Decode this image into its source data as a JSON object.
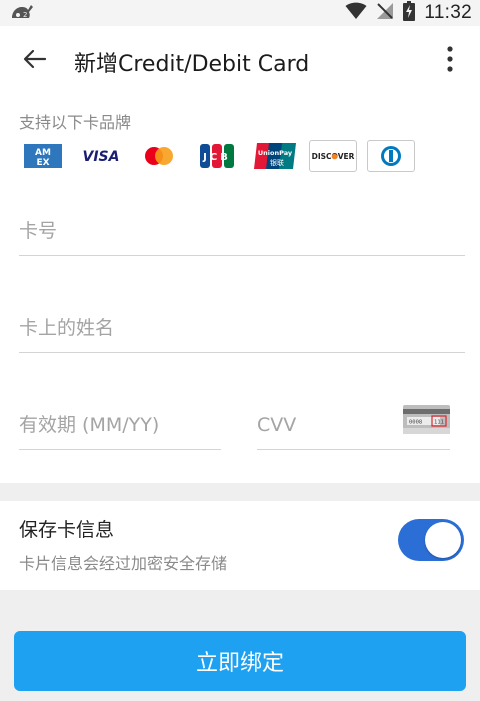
{
  "status": {
    "time": "11:32",
    "icons": [
      "notification-app-icon",
      "wifi-icon",
      "no-signal-icon",
      "battery-charging-icon"
    ]
  },
  "appbar": {
    "title": "新增Credit/Debit Card",
    "back_icon": "arrow-left-icon",
    "more_icon": "more-vertical-icon"
  },
  "brands": {
    "label": "支持以下卡品牌",
    "items": [
      {
        "name": "American Express",
        "text_line1": "AM",
        "text_line2": "EX",
        "color": "#2e77bc"
      },
      {
        "name": "Visa",
        "text": "VISA",
        "color": "#1a1f71"
      },
      {
        "name": "Mastercard",
        "colors": [
          "#eb001b",
          "#f79e1b"
        ]
      },
      {
        "name": "JCB",
        "text": "JCB",
        "colors": [
          "#0e4c96",
          "#e21836",
          "#007940"
        ]
      },
      {
        "name": "UnionPay",
        "text_line1": "UnionPay",
        "text_line2": "银联",
        "colors": [
          "#e21836",
          "#00447c",
          "#007b84"
        ]
      },
      {
        "name": "Discover",
        "text": "DISCOVER",
        "color": "#f58220"
      },
      {
        "name": "Diners Club",
        "color": "#0079be"
      }
    ]
  },
  "form": {
    "card_number_placeholder": "卡号",
    "holder_name_placeholder": "卡上的姓名",
    "expiry_placeholder": "有效期 (MM/YY)",
    "cvv_placeholder": "CVV",
    "cvv_sample_digits": "0008",
    "cvv_sample_code": "111"
  },
  "save_card": {
    "title": "保存卡信息",
    "description": "卡片信息会经过加密安全存储",
    "toggle_on": true,
    "toggle_color": "#2b6fd6"
  },
  "actions": {
    "bind_label": "立即绑定",
    "bind_color": "#1ea1f1"
  }
}
